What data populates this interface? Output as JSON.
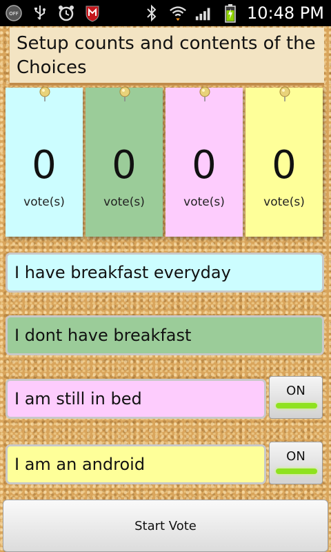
{
  "status_bar": {
    "time": "10:48 PM",
    "icons": [
      "off-badge-icon",
      "usb-icon",
      "alarm-icon",
      "mcafee-icon",
      "bluetooth-icon",
      "wifi-icon",
      "signal-icon",
      "battery-charging-icon"
    ],
    "off_badge_text": "OFF"
  },
  "header": {
    "title": "Setup counts and contents of the Choices"
  },
  "cards": [
    {
      "count": "0",
      "unit": "vote(s)",
      "color": "#ccfdff"
    },
    {
      "count": "0",
      "unit": "vote(s)",
      "color": "#9bcc99"
    },
    {
      "count": "0",
      "unit": "vote(s)",
      "color": "#fdccfd"
    },
    {
      "count": "0",
      "unit": "vote(s)",
      "color": "#feff99"
    }
  ],
  "choices": [
    {
      "text": "I have breakfast everyday",
      "color": "#ccfdff"
    },
    {
      "text": "I dont have breakfast",
      "color": "#9bcc99"
    },
    {
      "text": "I am still in bed",
      "color": "#fdccfd",
      "toggle": "ON"
    },
    {
      "text": "I am an android",
      "color": "#feff99",
      "toggle": "ON"
    }
  ],
  "start_button": {
    "label": "Start Vote"
  }
}
